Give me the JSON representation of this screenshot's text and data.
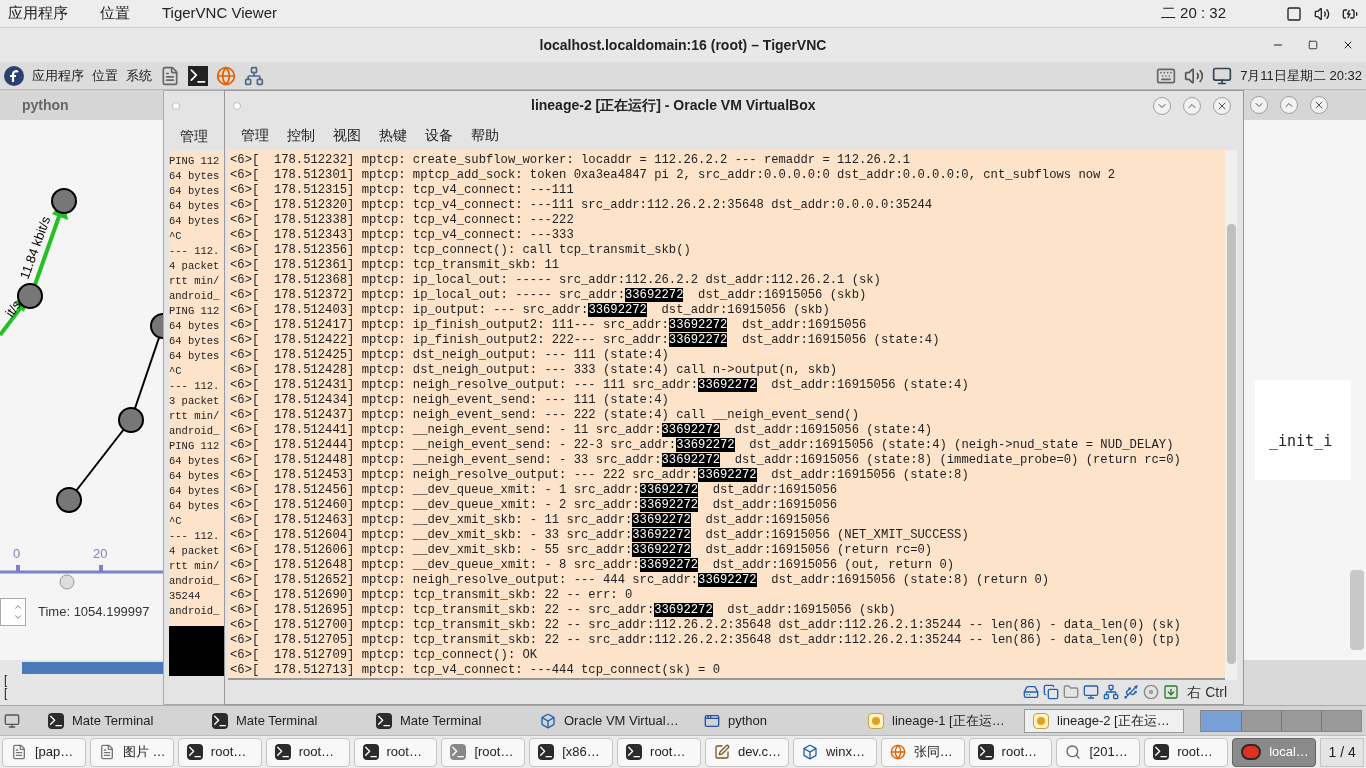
{
  "host_bar": {
    "menus": [
      "应用程序",
      "位置",
      "TigerVNC Viewer"
    ],
    "clock": "二 20 : 32"
  },
  "vnc_window": {
    "title": "localhost.localdomain:16 (root) – TigerVNC"
  },
  "guest_panel": {
    "menus": [
      "应用程序",
      "位置",
      "系统"
    ],
    "clock": "7月11日星期二 20:32"
  },
  "python_window": {
    "title": "python",
    "edge_labels": [
      "it/s",
      "11.84 kbit/s"
    ],
    "ticks": [
      "0",
      "20"
    ],
    "time": "Time: 1054.199997",
    "side_text": "_init_i",
    "brackets": [
      "[",
      "["
    ]
  },
  "lineage1_window": {
    "menu": "管理",
    "lines": [
      "PING 112",
      "64 bytes",
      "64 bytes",
      "64 bytes",
      "64 bytes",
      "^C",
      "--- 112.",
      "4 packet",
      "rtt min/",
      "android_",
      "PING 112",
      "64 bytes",
      "64 bytes",
      "64 bytes",
      "^C",
      "--- 112.",
      "3 packet",
      "rtt min/",
      "android_",
      "PING 112",
      "64 bytes",
      "64 bytes",
      "64 bytes",
      "64 bytes",
      "^C",
      "--- 112.",
      "4 packet",
      "rtt min/",
      "android_",
      "35244",
      "android_"
    ]
  },
  "vbox_window": {
    "title": "lineage-2 [正在运行] - Oracle VM VirtualBox",
    "menus": [
      "管理",
      "控制",
      "视图",
      "热键",
      "设备",
      "帮助"
    ],
    "console": [
      {
        "parts": [
          {
            "text": "<6>[  178.512232] mptcp: create_subflow_worker: locaddr = 112.26.2.2 --- remaddr = 112.26.2.1",
            "highlighted": false
          }
        ]
      },
      {
        "parts": [
          {
            "text": "<6>[  178.512301] mptcp: mptcp_add_sock: token 0xa3ea4847 pi 2, src_addr:0.0.0.0:0 dst_addr:0.0.0.0:0, cnt_subflows now 2",
            "highlighted": false
          }
        ]
      },
      {
        "parts": [
          {
            "text": "<6>[  178.512315] mptcp: tcp_v4_connect: ---111",
            "highlighted": false
          }
        ]
      },
      {
        "parts": [
          {
            "text": "<6>[  178.512320] mptcp: tcp_v4_connect: ---111 src_addr:112.26.2.2:35648 dst_addr:0.0.0.0:35244",
            "highlighted": false
          }
        ]
      },
      {
        "parts": [
          {
            "text": "<6>[  178.512338] mptcp: tcp_v4_connect: ---222",
            "highlighted": false
          }
        ]
      },
      {
        "parts": [
          {
            "text": "<6>[  178.512343] mptcp: tcp_v4_connect: ---333",
            "highlighted": false
          }
        ]
      },
      {
        "parts": [
          {
            "text": "<6>[  178.512356] mptcp: tcp_connect(): call tcp_transmit_skb()",
            "highlighted": false
          }
        ]
      },
      {
        "parts": [
          {
            "text": "<6>[  178.512361] mptcp: tcp_transmit_skb: 11",
            "highlighted": false
          }
        ]
      },
      {
        "parts": [
          {
            "text": "<6>[  178.512368] mptcp: ip_local_out: ----- src_addr:112.26.2.2 dst_addr:112.26.2.1 (sk)",
            "highlighted": false
          }
        ]
      },
      {
        "parts": [
          {
            "text": "<6>[  178.512372] mptcp: ip_local_out: ----- src_addr:",
            "highlighted": false
          },
          {
            "text": "33692272",
            "highlighted": true
          },
          {
            "text": "  dst_addr:16915056 (skb)",
            "highlighted": false
          }
        ]
      },
      {
        "parts": [
          {
            "text": "<6>[  178.512403] mptcp: ip_output: --- src_addr:",
            "highlighted": false
          },
          {
            "text": "33692272",
            "highlighted": true
          },
          {
            "text": "  dst_addr:16915056 (skb)",
            "highlighted": false
          }
        ]
      },
      {
        "parts": [
          {
            "text": "<6>[  178.512417] mptcp: ip_finish_output2: 111--- src_addr:",
            "highlighted": false
          },
          {
            "text": "33692272",
            "highlighted": true
          },
          {
            "text": "  dst_addr:16915056",
            "highlighted": false
          }
        ]
      },
      {
        "parts": [
          {
            "text": "<6>[  178.512422] mptcp: ip_finish_output2: 222--- src_addr:",
            "highlighted": false
          },
          {
            "text": "33692272",
            "highlighted": true
          },
          {
            "text": "  dst_addr:16915056 (state:4)",
            "highlighted": false
          }
        ]
      },
      {
        "parts": [
          {
            "text": "<6>[  178.512425] mptcp: dst_neigh_output: --- 111 (state:4)",
            "highlighted": false
          }
        ]
      },
      {
        "parts": [
          {
            "text": "<6>[  178.512428] mptcp: dst_neigh_output: --- 333 (state:4) call n->output(n, skb)",
            "highlighted": false
          }
        ]
      },
      {
        "parts": [
          {
            "text": "<6>[  178.512431] mptcp: neigh_resolve_output: --- 111 src_addr:",
            "highlighted": false
          },
          {
            "text": "33692272",
            "highlighted": true
          },
          {
            "text": "  dst_addr:16915056 (state:4)",
            "highlighted": false
          }
        ]
      },
      {
        "parts": [
          {
            "text": "<6>[  178.512434] mptcp: neigh_event_send: --- 111 (state:4)",
            "highlighted": false
          }
        ]
      },
      {
        "parts": [
          {
            "text": "<6>[  178.512437] mptcp: neigh_event_send: --- 222 (state:4) call __neigh_event_send()",
            "highlighted": false
          }
        ]
      },
      {
        "parts": [
          {
            "text": "<6>[  178.512441] mptcp: __neigh_event_send: - 11 src_addr:",
            "highlighted": false
          },
          {
            "text": "33692272",
            "highlighted": true
          },
          {
            "text": "  dst_addr:16915056 (state:4)",
            "highlighted": false
          }
        ]
      },
      {
        "parts": [
          {
            "text": "<6>[  178.512444] mptcp: __neigh_event_send: - 22-3 src_addr:",
            "highlighted": false
          },
          {
            "text": "33692272",
            "highlighted": true
          },
          {
            "text": "  dst_addr:16915056 (state:4) (neigh->nud_state = NUD_DELAY)",
            "highlighted": false
          }
        ]
      },
      {
        "parts": [
          {
            "text": "<6>[  178.512448] mptcp: __neigh_event_send: - 33 src_addr:",
            "highlighted": false
          },
          {
            "text": "33692272",
            "highlighted": true
          },
          {
            "text": "  dst_addr:16915056 (state:8) (immediate_probe=0) (return rc=0)",
            "highlighted": false
          }
        ]
      },
      {
        "parts": [
          {
            "text": "<6>[  178.512453] mptcp: neigh_resolve_output: --- 222 src_addr:",
            "highlighted": false
          },
          {
            "text": "33692272",
            "highlighted": true
          },
          {
            "text": "  dst_addr:16915056 (state:8)",
            "highlighted": false
          }
        ]
      },
      {
        "parts": [
          {
            "text": "<6>[  178.512456] mptcp: __dev_queue_xmit: - 1 src_addr:",
            "highlighted": false
          },
          {
            "text": "33692272",
            "highlighted": true
          },
          {
            "text": "  dst_addr:16915056",
            "highlighted": false
          }
        ]
      },
      {
        "parts": [
          {
            "text": "<6>[  178.512460] mptcp: __dev_queue_xmit: - 2 src_addr:",
            "highlighted": false
          },
          {
            "text": "33692272",
            "highlighted": true
          },
          {
            "text": "  dst_addr:16915056",
            "highlighted": false
          }
        ]
      },
      {
        "parts": [
          {
            "text": "<6>[  178.512463] mptcp: __dev_xmit_skb: - 11 src_addr:",
            "highlighted": false
          },
          {
            "text": "33692272",
            "highlighted": true
          },
          {
            "text": "  dst_addr:16915056",
            "highlighted": false
          }
        ]
      },
      {
        "parts": [
          {
            "text": "<6>[  178.512604] mptcp: __dev_xmit_skb: - 33 src_addr:",
            "highlighted": false
          },
          {
            "text": "33692272",
            "highlighted": true
          },
          {
            "text": "  dst_addr:16915056 (NET_XMIT_SUCCESS)",
            "highlighted": false
          }
        ]
      },
      {
        "parts": [
          {
            "text": "<6>[  178.512606] mptcp: __dev_xmit_skb: - 55 src_addr:",
            "highlighted": false
          },
          {
            "text": "33692272",
            "highlighted": true
          },
          {
            "text": "  dst_addr:16915056 (return rc=0)",
            "highlighted": false
          }
        ]
      },
      {
        "parts": [
          {
            "text": "<6>[  178.512648] mptcp: __dev_queue_xmit: - 8 src_addr:",
            "highlighted": false
          },
          {
            "text": "33692272",
            "highlighted": true
          },
          {
            "text": "  dst_addr:16915056 (out, return 0)",
            "highlighted": false
          }
        ]
      },
      {
        "parts": [
          {
            "text": "<6>[  178.512652] mptcp: neigh_resolve_output: --- 444 src_addr:",
            "highlighted": false
          },
          {
            "text": "33692272",
            "highlighted": true
          },
          {
            "text": "  dst_addr:16915056 (state:8) (return 0)",
            "highlighted": false
          }
        ]
      },
      {
        "parts": [
          {
            "text": "<6>[  178.512690] mptcp: tcp_transmit_skb: 22 -- err: 0",
            "highlighted": false
          }
        ]
      },
      {
        "parts": [
          {
            "text": "<6>[  178.512695] mptcp: tcp_transmit_skb: 22 -- src_addr:",
            "highlighted": false
          },
          {
            "text": "33692272",
            "highlighted": true
          },
          {
            "text": "  dst_addr:16915056 (skb)",
            "highlighted": false
          }
        ]
      },
      {
        "parts": [
          {
            "text": "<6>[  178.512700] mptcp: tcp_transmit_skb: 22 -- src_addr:112.26.2.2:35648 dst_addr:112.26.2.1:35244 -- len(86) - data_len(0) (sk)",
            "highlighted": false
          }
        ]
      },
      {
        "parts": [
          {
            "text": "<6>[  178.512705] mptcp: tcp_transmit_skb: 22 -- src_addr:112.26.2.2:35648 dst_addr:112.26.2.1:35244 -- len(86) - data_len(0) (tp)",
            "highlighted": false
          }
        ]
      },
      {
        "parts": [
          {
            "text": "<6>[  178.512709] mptcp: tcp_connect(): OK",
            "highlighted": false
          }
        ]
      },
      {
        "parts": [
          {
            "text": "<6>[  178.512713] mptcp: tcp_v4_connect: ---444 tcp_connect(sk) = 0",
            "highlighted": false
          }
        ]
      }
    ],
    "host_key": "右 Ctrl"
  },
  "vnc_taskbar": [
    {
      "label": "Mate Terminal",
      "kind": "terminal",
      "selected": false
    },
    {
      "label": "Mate Terminal",
      "kind": "terminal",
      "selected": false
    },
    {
      "label": "Mate Terminal",
      "kind": "terminal",
      "selected": false
    },
    {
      "label": "Oracle VM Virtual…",
      "kind": "virtualbox",
      "selected": false
    },
    {
      "label": "python",
      "kind": "window",
      "selected": false
    },
    {
      "label": "lineage-1 [正在运…",
      "kind": "vm",
      "selected": false
    },
    {
      "label": "lineage-2 [正在运…",
      "kind": "vm",
      "selected": true
    }
  ],
  "host_taskbar": [
    {
      "label": "[pap…",
      "kind": "document",
      "selected": false
    },
    {
      "label": "图片 …",
      "kind": "document",
      "selected": false
    },
    {
      "label": "root…",
      "kind": "terminal",
      "selected": false
    },
    {
      "label": "root…",
      "kind": "terminal",
      "selected": false
    },
    {
      "label": "root…",
      "kind": "terminal",
      "selected": false
    },
    {
      "label": "[root…",
      "kind": "terminal-grey",
      "selected": false
    },
    {
      "label": "[x86…",
      "kind": "terminal",
      "selected": false
    },
    {
      "label": "root…",
      "kind": "terminal",
      "selected": false
    },
    {
      "label": "dev.c…",
      "kind": "editor",
      "selected": false
    },
    {
      "label": "winx…",
      "kind": "virtualbox",
      "selected": false
    },
    {
      "label": "张同…",
      "kind": "browser",
      "selected": false
    },
    {
      "label": "root…",
      "kind": "terminal",
      "selected": false
    },
    {
      "label": "[201…",
      "kind": "search",
      "selected": false
    },
    {
      "label": "root…",
      "kind": "terminal",
      "selected": false
    },
    {
      "label": "local…",
      "kind": "vnc",
      "selected": true
    }
  ],
  "workspace": "1 / 4"
}
